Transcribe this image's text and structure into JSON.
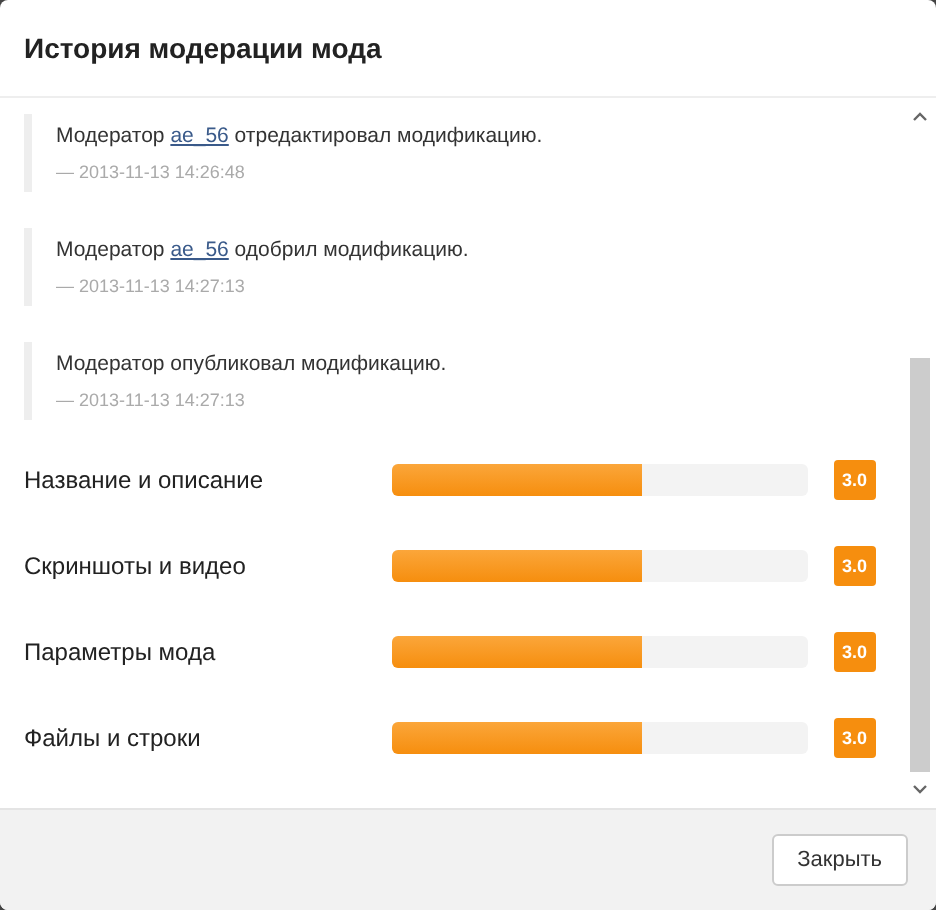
{
  "dialog": {
    "title": "История модерации мода"
  },
  "history": [
    {
      "before": "Модератор ",
      "link": "ae_56",
      "after": " отредактировал модификацию.",
      "date": "— 2013-11-13 14:26:48"
    },
    {
      "before": "Модератор ",
      "link": "ae_56",
      "after": " одобрил модификацию.",
      "date": "— 2013-11-13 14:27:13"
    },
    {
      "before": "Модератор опубликовал модификацию.",
      "date": "— 2013-11-13 14:27:13"
    }
  ],
  "ratings": [
    {
      "label": "Название и описание",
      "level": 0.6,
      "score": "3.0"
    },
    {
      "label": "Скриншоты и видео",
      "level": 0.6,
      "score": "3.0"
    },
    {
      "label": "Параметры мода",
      "level": 0.6,
      "score": "3.0"
    },
    {
      "label": "Файлы и строки",
      "level": 0.6,
      "score": "3.0"
    }
  ],
  "footer": {
    "button": "Закрыть"
  }
}
